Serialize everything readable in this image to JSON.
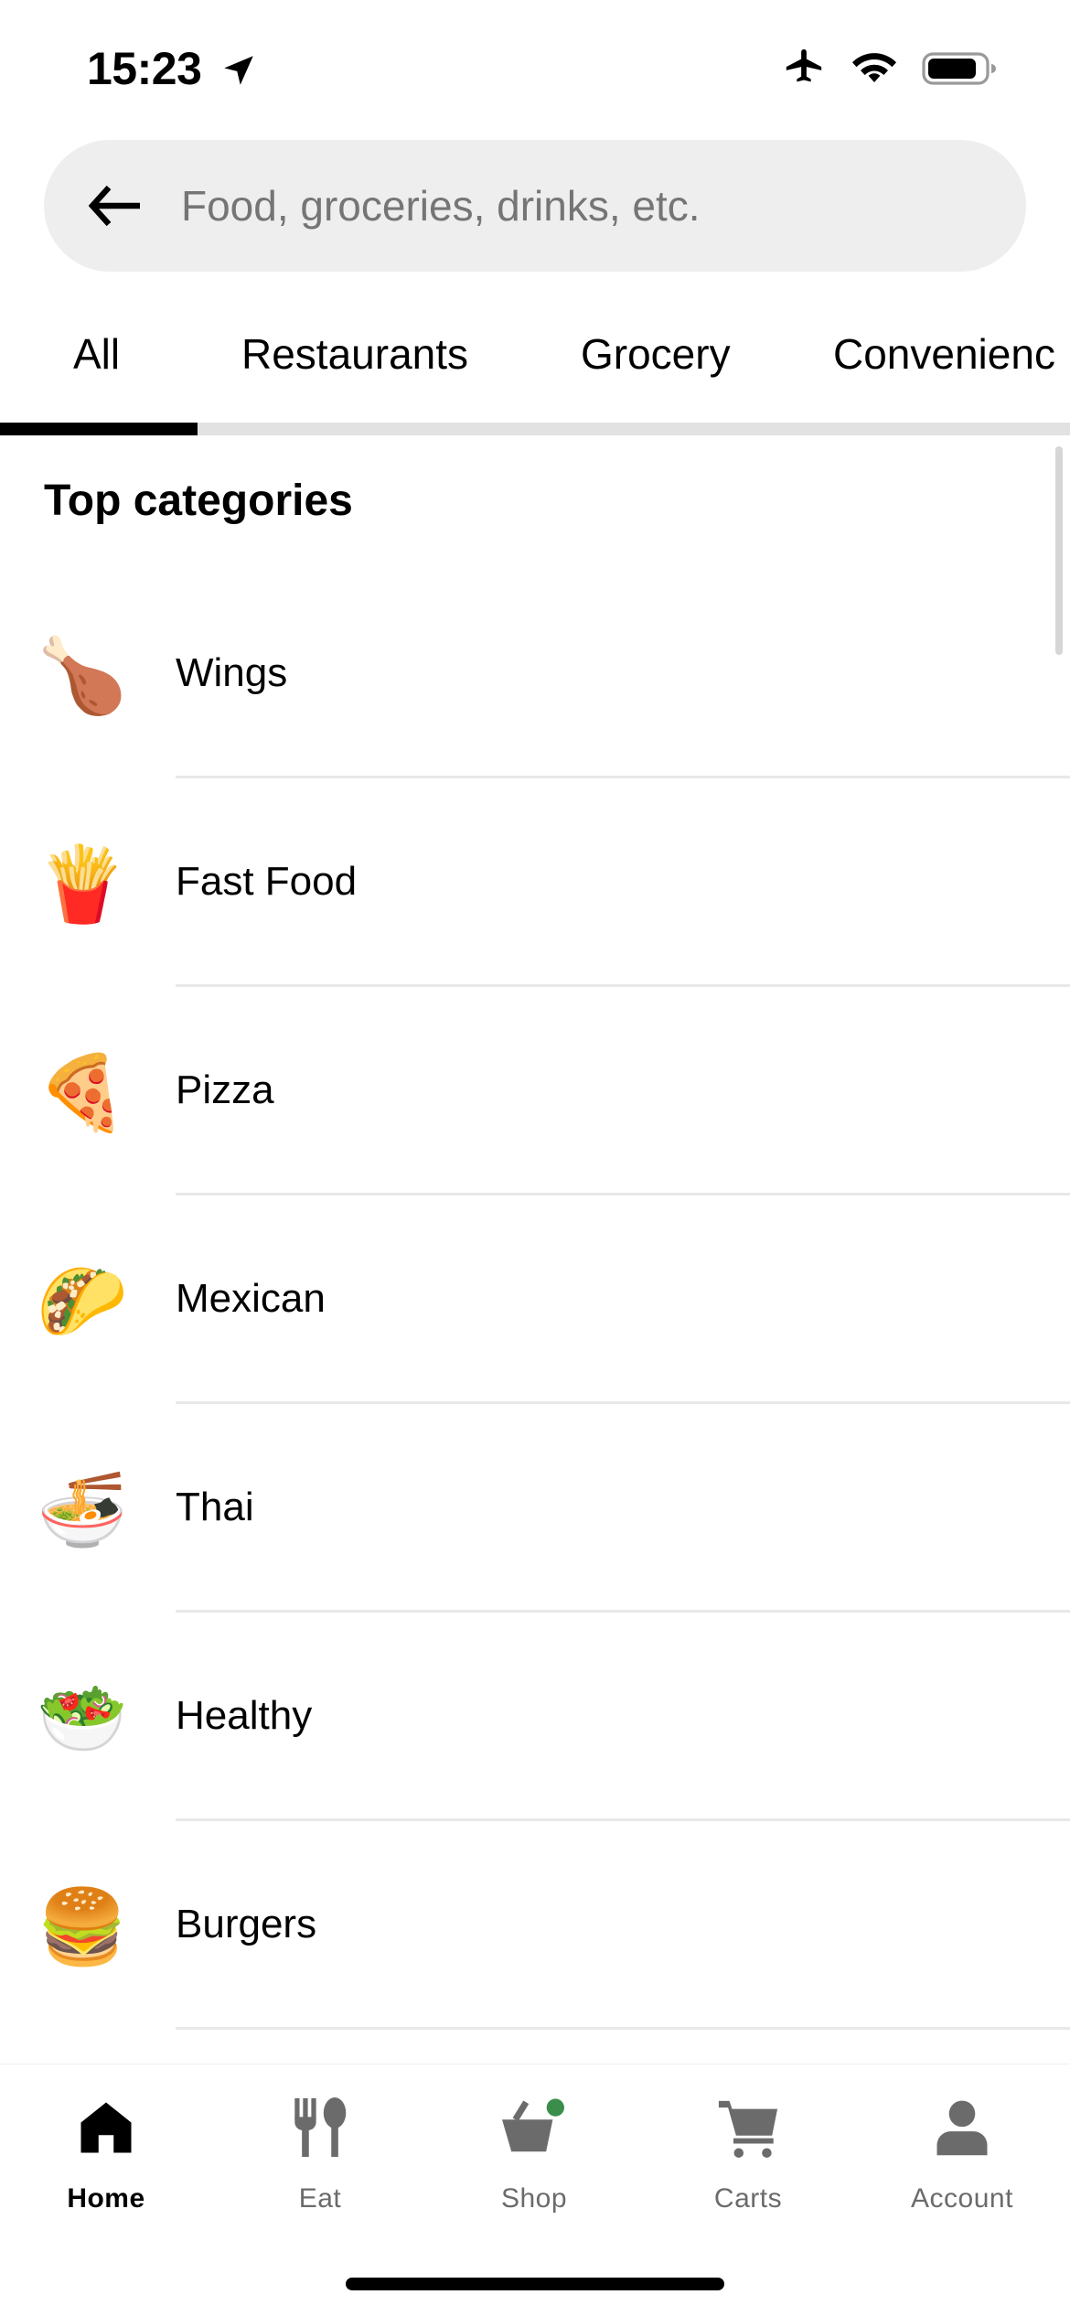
{
  "status_bar": {
    "time": "15:23"
  },
  "search": {
    "placeholder": "Food, groceries, drinks, etc."
  },
  "tabs": [
    {
      "label": "All",
      "active": true
    },
    {
      "label": "Restaurants"
    },
    {
      "label": "Grocery"
    },
    {
      "label": "Convenienc"
    }
  ],
  "section": {
    "title": "Top categories"
  },
  "categories": [
    {
      "label": "Wings",
      "icon": "🍗"
    },
    {
      "label": "Fast Food",
      "icon": "🍟"
    },
    {
      "label": "Pizza",
      "icon": "🍕"
    },
    {
      "label": "Mexican",
      "icon": "🌮"
    },
    {
      "label": "Thai",
      "icon": "🍜"
    },
    {
      "label": "Healthy",
      "icon": "🥗"
    },
    {
      "label": "Burgers",
      "icon": "🍔"
    }
  ],
  "bottom_nav": [
    {
      "label": "Home",
      "icon": "home-icon",
      "active": true
    },
    {
      "label": "Eat",
      "icon": "utensils-icon"
    },
    {
      "label": "Shop",
      "icon": "shopping-basket-icon"
    },
    {
      "label": "Carts",
      "icon": "cart-icon"
    },
    {
      "label": "Account",
      "icon": "account-icon"
    }
  ],
  "colors": {
    "accent": "#000000",
    "badge": "#3a8d4a",
    "search_bg": "#eeeeee"
  }
}
